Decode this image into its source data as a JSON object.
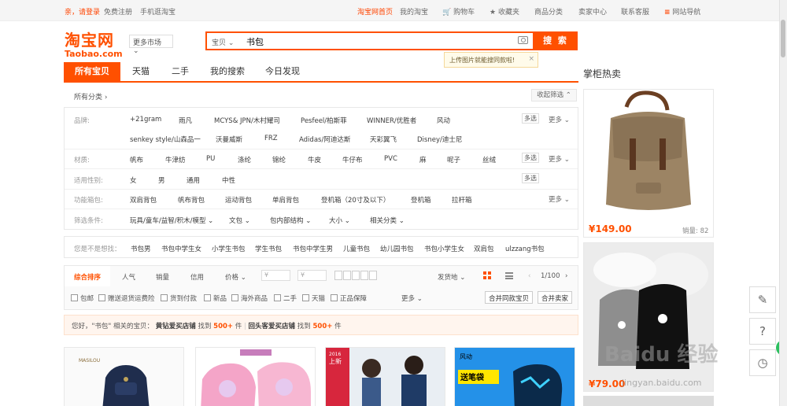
{
  "topbar": {
    "greeting": "亲，请登录",
    "register": "免费注册",
    "mobile": "手机逛淘宝",
    "home": "淘宝网首页",
    "my_taobao": "我的淘宝",
    "cart": "购物车",
    "favorites": "收藏夹",
    "categories": "商品分类",
    "seller_center": "卖家中心",
    "service": "联系客服",
    "site_nav": "网站导航"
  },
  "header": {
    "logo_cn": "淘宝网",
    "logo_en": "Taobao.com",
    "more_market": "更多市场",
    "search_type": "宝贝",
    "search_value": "书包",
    "search_button": "搜 索",
    "tip": "上传图片就能搜同款啦!"
  },
  "tabs": [
    "所有宝贝",
    "天猫",
    "二手",
    "我的搜索",
    "今日发现"
  ],
  "filters": {
    "all_categories": "所有分类",
    "collapse": "收起筛选",
    "multi": "多选",
    "more": "更多",
    "brand_label": "品牌:",
    "brands_row1": [
      "+21gram",
      "雨凡",
      "MCYS& JPN/木村耀司",
      "Pesfeel/柏斯菲",
      "WINNER/优胜者",
      "风动"
    ],
    "brands_row2": [
      "senkey style/山森品一",
      "沃曼威斯",
      "FRZ",
      "Adidas/阿迪达斯",
      "天彩翼飞",
      "Disney/迪士尼"
    ],
    "material_label": "材质:",
    "materials": [
      "帆布",
      "牛津纺",
      "PU",
      "涤纶",
      "锦纶",
      "牛皮",
      "牛仔布",
      "PVC",
      "麻",
      "呢子",
      "丝绒"
    ],
    "gender_label": "适用性别:",
    "genders": [
      "女",
      "男",
      "通用",
      "中性"
    ],
    "func_label": "功能箱包:",
    "funcs": [
      "双肩背包",
      "帆布背包",
      "运动背包",
      "单肩背包",
      "登机箱（20寸及以下）",
      "登机箱",
      "拉杆箱"
    ],
    "cond_label": "筛选条件:",
    "conditions": [
      "玩具/童车/益智/积木/模型",
      "文包",
      "包内部结构",
      "大小",
      "相关分类"
    ]
  },
  "suggest": {
    "label": "您是不是想找：",
    "items": [
      "书包男",
      "书包中学生女",
      "小学生书包",
      "学生书包",
      "书包中学生男",
      "儿童书包",
      "幼儿园书包",
      "书包小学生女",
      "双肩包",
      "ulzzang书包"
    ]
  },
  "sort": {
    "items": [
      "综合排序",
      "人气",
      "销量",
      "信用",
      "价格"
    ],
    "price_placeholder": "¥",
    "ship_from": "发货地",
    "pager": "1/100",
    "checks": [
      "包邮",
      "赠送退货运费险",
      "货到付款",
      "新品",
      "海外商品",
      "二手",
      "天猫",
      "正品保障"
    ],
    "more": "更多",
    "merge_same": "合并同款宝贝",
    "merge_seller": "合并卖家"
  },
  "notice": {
    "prefix": "您好，\"书包\" 相关的宝贝：",
    "diamond": "黄钻爱买店铺",
    "found": "找到",
    "count1": "500+",
    "unit": "件",
    "sep": "|",
    "repeat": "回头客爱买店铺",
    "count2": "500+"
  },
  "right": {
    "title": "掌柜热卖",
    "item1_price": "¥149.00",
    "item1_sales": "销量: 82",
    "item2_price": "¥79.00"
  },
  "product_labels": {
    "p1_brand": "MASILOU",
    "p3_badge": "上新",
    "p3_year": "2016",
    "p4_top": "风动",
    "p4_text": "送笔袋"
  },
  "watermark": {
    "text": "Baidu 经验",
    "url": "jingyan.baidu.com"
  },
  "colors": {
    "accent": "#ff5000"
  }
}
